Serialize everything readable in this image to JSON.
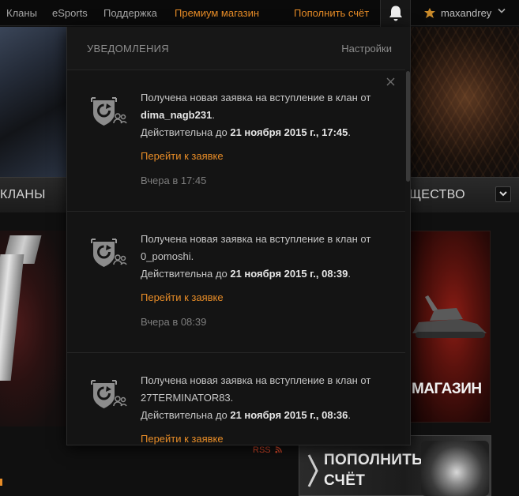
{
  "topnav": {
    "links": [
      {
        "label": "Кланы"
      },
      {
        "label": "eSports"
      },
      {
        "label": "Поддержка"
      },
      {
        "label": "Премиум магазин"
      },
      {
        "label": "Пополнить счёт"
      }
    ],
    "user": {
      "name": "maxandrey"
    }
  },
  "background": {
    "bar_left_label": "КЛАНЫ",
    "bar_right_label": "ЩЕСТВО",
    "shop_label": "МАГАЗИН",
    "rss_label": "RSS",
    "topup_line1": "ПОПОЛНИТЬ",
    "topup_line2": "СЧЁТ"
  },
  "notifications_panel": {
    "title": "УВЕДОМЛЕНИЯ",
    "settings_label": "Настройки",
    "items": [
      {
        "text_prefix": "Получена новая заявка на вступление в клан от",
        "player": "dima_nagb231",
        "valid_prefix": "Действительна до",
        "valid_until": "21 ноября 2015 г., 17:45",
        "link": "Перейти к заявке",
        "time": "Вчера в 17:45"
      },
      {
        "text_prefix": "Получена новая заявка на вступление в клан от",
        "player": "0_pomoshi",
        "valid_prefix": "Действительна до",
        "valid_until": "21 ноября 2015 г., 08:39",
        "link": "Перейти к заявке",
        "time": "Вчера в 08:39"
      },
      {
        "text_prefix": "Получена новая заявка на вступление в клан от",
        "player": "27TERMINATOR83",
        "valid_prefix": "Действительна до",
        "valid_until": "21 ноября 2015 г., 08:36",
        "link": "Перейти к заявке",
        "time": ""
      }
    ]
  },
  "colors": {
    "accent": "#e78c27",
    "panel_bg": "#141414",
    "nav_bg": "#0a0a0a"
  }
}
